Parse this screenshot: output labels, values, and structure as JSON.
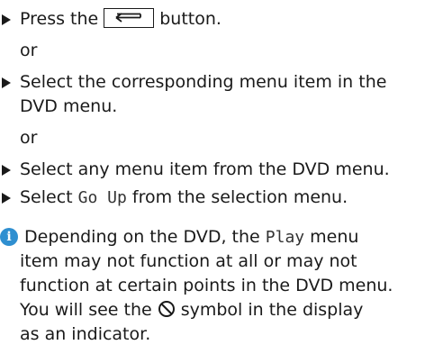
{
  "steps": [
    {
      "kind": "bullet",
      "before": "Press the",
      "key_icon": "back-arrow-icon",
      "after": "button."
    },
    {
      "kind": "or",
      "text": "or"
    },
    {
      "kind": "bullet",
      "line1": "Select the corresponding menu item in the",
      "line2": "DVD menu."
    },
    {
      "kind": "or",
      "text": "or"
    },
    {
      "kind": "bullet",
      "text": "Select any menu item from the DVD menu."
    },
    {
      "kind": "bullet",
      "before": "Select",
      "mono": "Go Up",
      "after": "from the selection menu."
    }
  ],
  "note": {
    "icon": "info-icon",
    "icon_glyph": "i",
    "line1_before": "Depending on the DVD, the",
    "line1_mono": "Play",
    "line1_after": "menu",
    "line2": "item may not function at all or may not",
    "line3": "function at certain points in the DVD menu.",
    "line4_before": "You will see the",
    "line4_symbol": "prohibited-icon",
    "line4_after": "symbol in the display",
    "line5": "as an indicator."
  }
}
